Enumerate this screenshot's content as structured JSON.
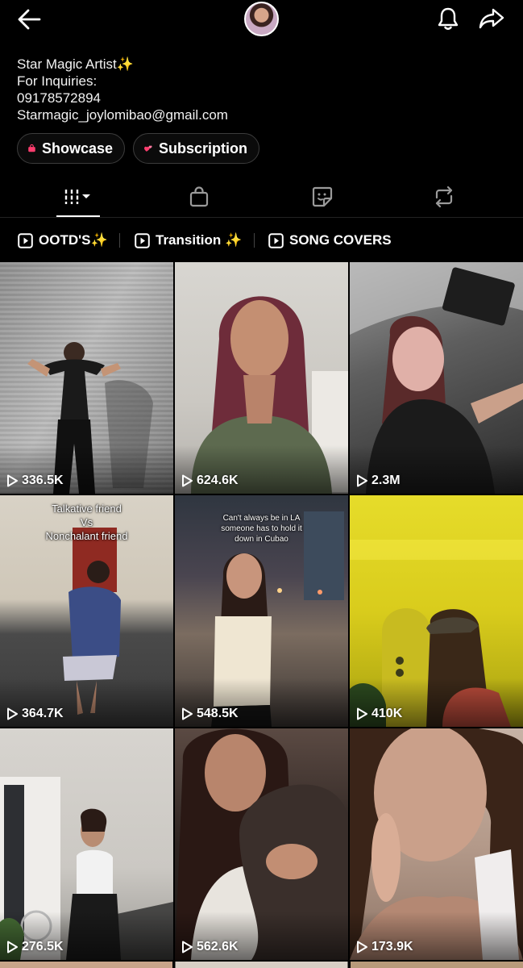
{
  "header": {
    "back_icon": "arrow-left-icon",
    "avatar_icon": "profile-avatar",
    "notification_icon": "bell-icon",
    "share_icon": "share-arrow-icon"
  },
  "bio": {
    "lines": [
      "Star Magic Artist✨",
      "For Inquiries:",
      "09178572894",
      "Starmagic_joylomibao@gmail.com"
    ]
  },
  "pills": {
    "showcase": {
      "label": "Showcase",
      "icon": "shopping-bag-icon"
    },
    "subscription": {
      "label": "Subscription",
      "icon": "hearts-icon"
    }
  },
  "tabs": [
    {
      "icon": "grid-dropdown-icon",
      "active": true
    },
    {
      "icon": "shopping-bag-icon",
      "active": false
    },
    {
      "icon": "sticker-icon",
      "active": false
    },
    {
      "icon": "repost-icon",
      "active": false
    }
  ],
  "playlists": [
    {
      "label": "OOTD'S✨",
      "icon": "play-square-icon"
    },
    {
      "label": "Transition ✨",
      "icon": "play-square-icon"
    },
    {
      "label": "SONG COVERS",
      "icon": "play-square-icon"
    }
  ],
  "videos": [
    {
      "views": "336.5K",
      "caption": ""
    },
    {
      "views": "624.6K",
      "caption": ""
    },
    {
      "views": "2.3M",
      "caption": ""
    },
    {
      "views": "364.7K",
      "caption": "Talkative friend\nVs\nNonchalant friend"
    },
    {
      "views": "548.5K",
      "caption": "Can't always be in LA\nsomeone has to hold it\ndown in Cubao"
    },
    {
      "views": "410K",
      "caption": ""
    },
    {
      "views": "276.5K",
      "caption": ""
    },
    {
      "views": "562.6K",
      "caption": ""
    },
    {
      "views": "173.9K",
      "caption": ""
    }
  ],
  "colors": {
    "background": "#000000",
    "text": "#ffffff",
    "pill_border": "#3c3c3c",
    "pill_icon_pink": "#ff3d6e"
  }
}
